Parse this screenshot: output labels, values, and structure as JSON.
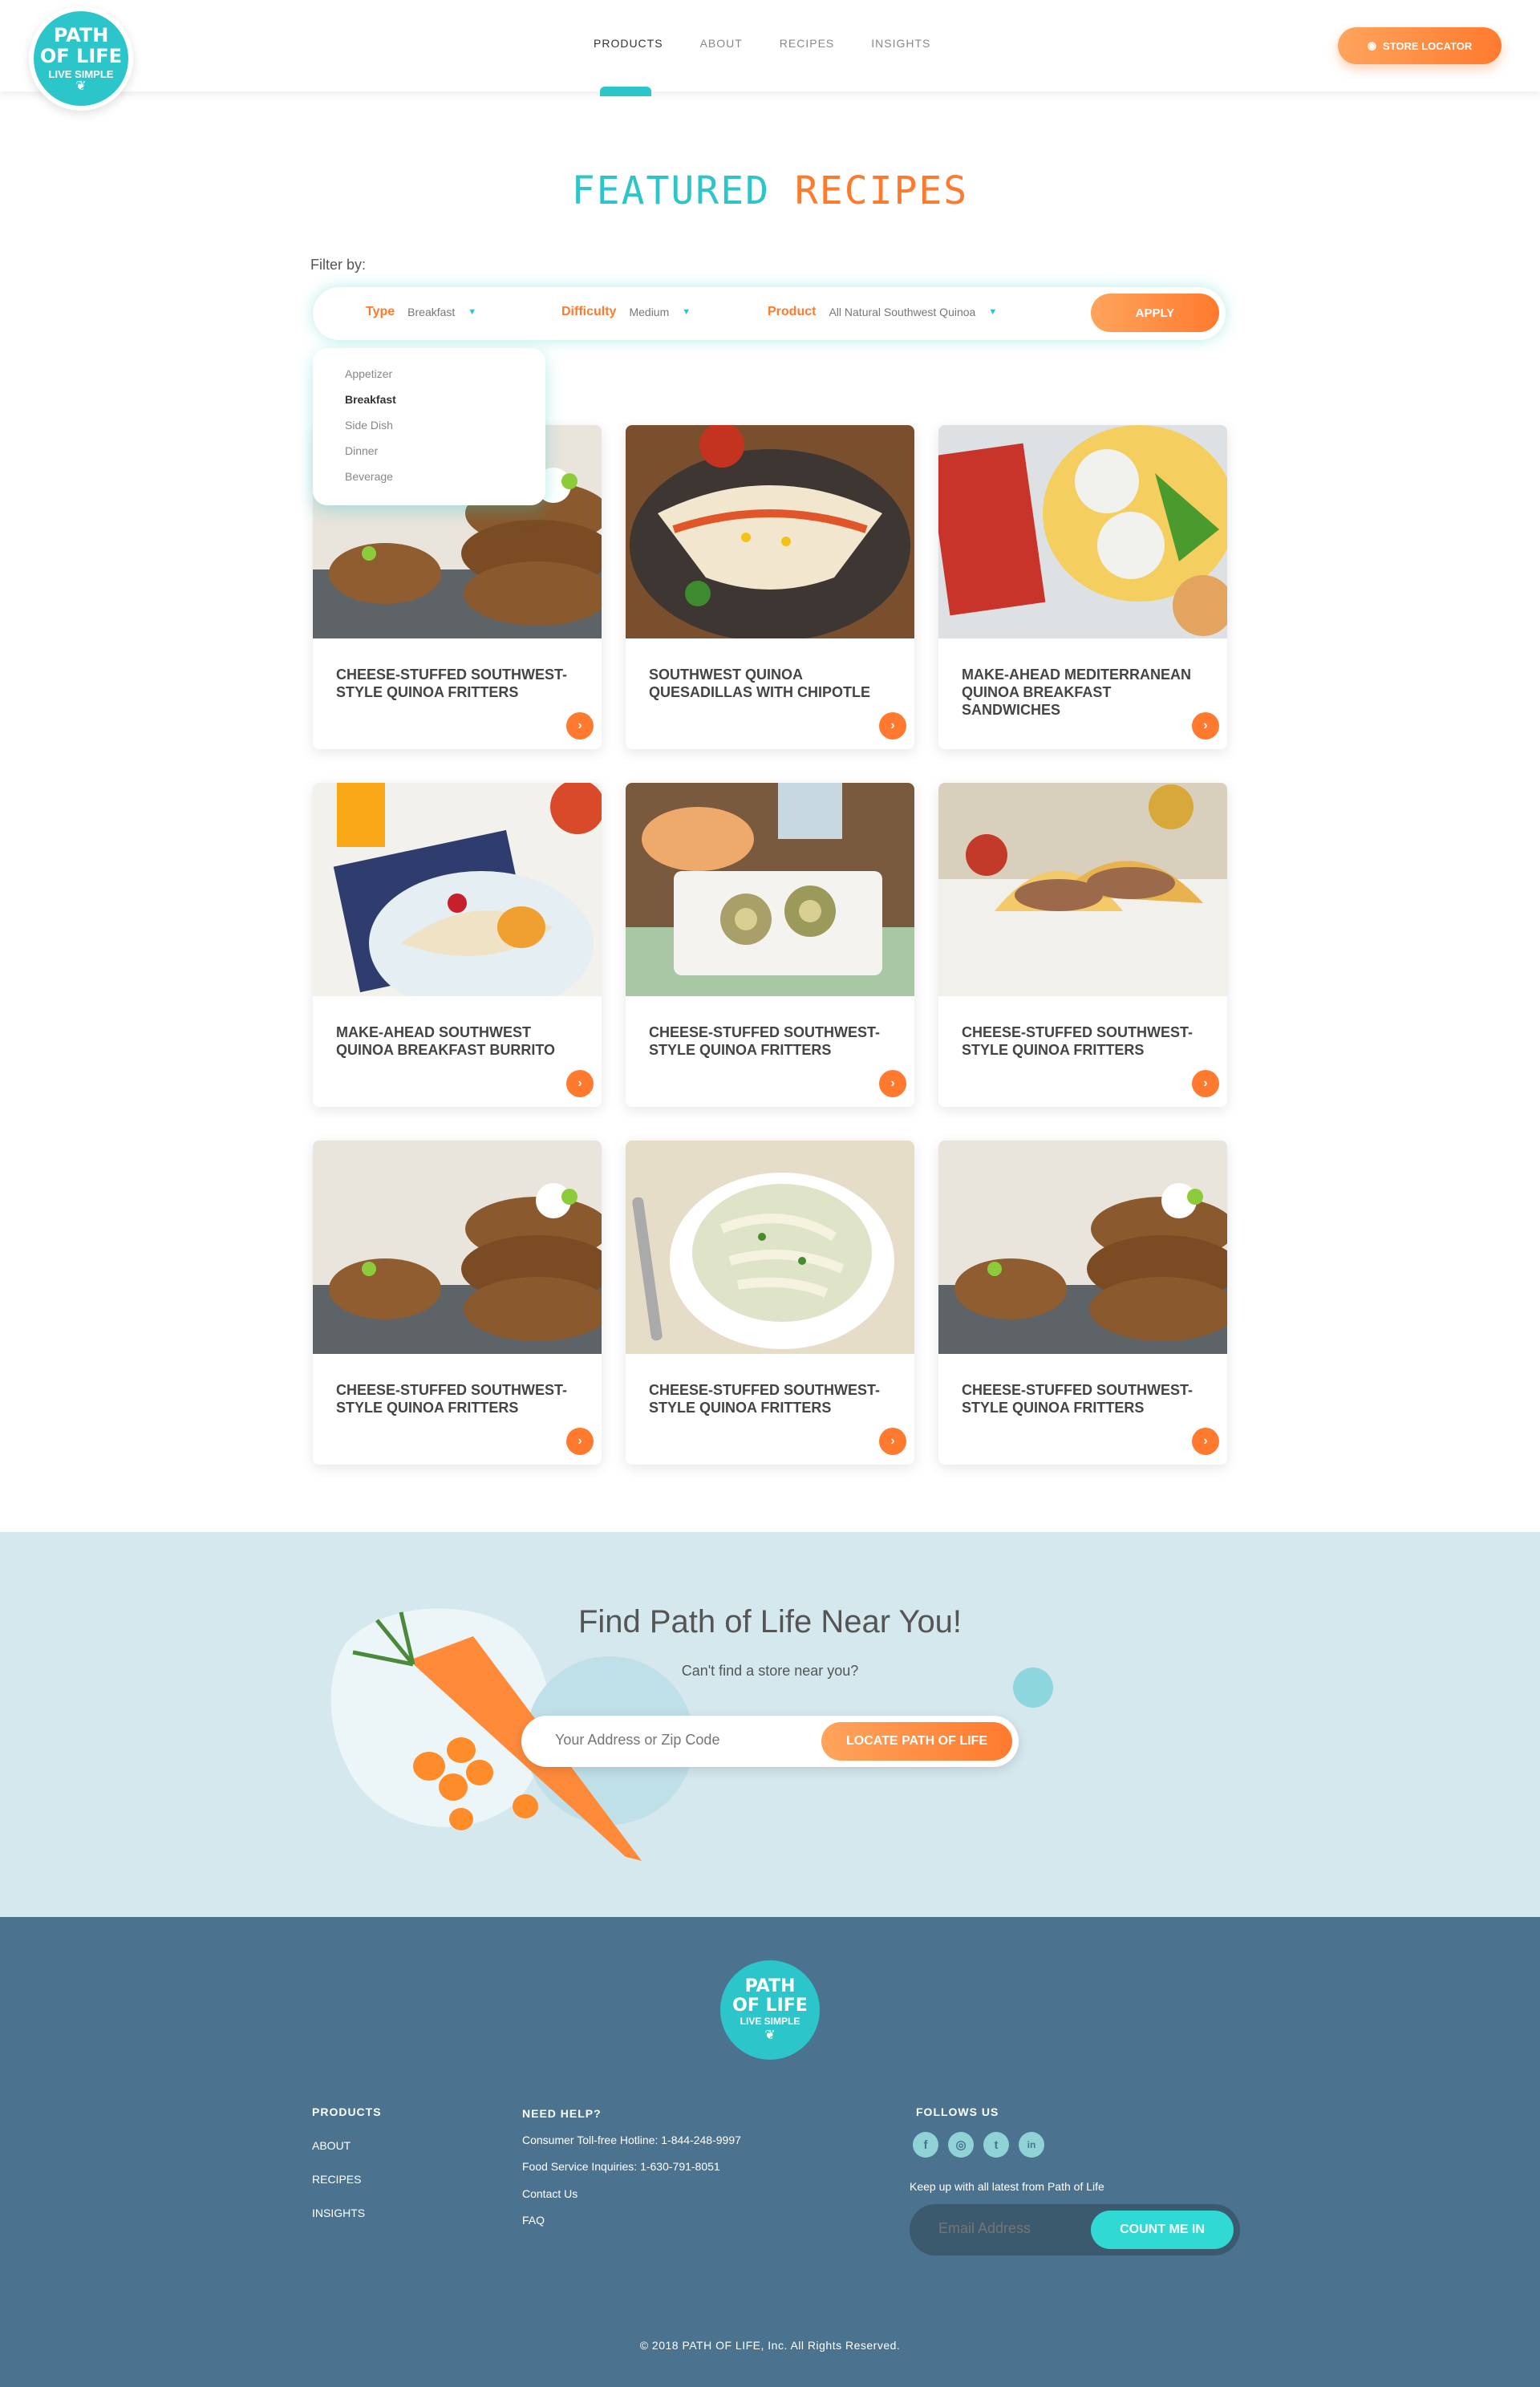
{
  "brand": {
    "logo_line1": "PATH",
    "logo_line2": "OF LIFE",
    "logo_tagline": "LIVE SIMPLE"
  },
  "nav": {
    "items": [
      "PRODUCTS",
      "ABOUT",
      "RECIPES",
      "INSIGHTS"
    ],
    "active": "PRODUCTS",
    "store_locator": "STORE LOCATOR"
  },
  "featured": {
    "title_part1": "FEATURED",
    "title_part2": "RECIPES"
  },
  "filter": {
    "label": "Filter by:",
    "type_label": "Type",
    "type_value": "Breakfast",
    "difficulty_label": "Difficulty",
    "difficulty_value": "Medium",
    "product_label": "Product",
    "product_value": "All Natural Southwest Quinoa",
    "apply": "APPLY",
    "type_options": [
      "Appetizer",
      "Breakfast",
      "Side Dish",
      "Dinner",
      "Beverage"
    ],
    "type_selected": "Breakfast"
  },
  "recipes": [
    {
      "title": "CHEESE-STUFFED SOUTHWEST-STYLE QUINOA FRITTERS",
      "image": "fritters"
    },
    {
      "title": "SOUTHWEST QUINOA QUESADILLAS WITH  CHIPOTLE",
      "image": "quesadilla"
    },
    {
      "title": "MAKE-AHEAD MEDITERRANEAN QUINOA BREAKFAST SANDWICHES",
      "image": "sandwich"
    },
    {
      "title": "MAKE-AHEAD SOUTHWEST QUINOA BREAKFAST BURRITO",
      "image": "burrito"
    },
    {
      "title": "CHEESE-STUFFED SOUTHWEST-STYLE QUINOA FRITTERS",
      "image": "pinwheels"
    },
    {
      "title": "CHEESE-STUFFED SOUTHWEST-STYLE QUINOA FRITTERS",
      "image": "tacos"
    },
    {
      "title": "CHEESE-STUFFED SOUTHWEST-STYLE QUINOA FRITTERS",
      "image": "fritters"
    },
    {
      "title": "CHEESE-STUFFED SOUTHWEST-STYLE QUINOA FRITTERS",
      "image": "soup"
    },
    {
      "title": "CHEESE-STUFFED SOUTHWEST-STYLE QUINOA FRITTERS",
      "image": "fritters"
    }
  ],
  "find": {
    "title": "Find Path of Life Near You!",
    "subtitle": "Can't find a store near you?",
    "placeholder": "Your Address or Zip Code",
    "button": "LOCATE PATH OF LIFE"
  },
  "footer": {
    "links": [
      "PRODUCTS",
      "ABOUT",
      "RECIPES",
      "INSIGHTS"
    ],
    "need_help": "NEED HELP?",
    "help_items": [
      "Consumer Toll-free Hotline: 1-844-248-9997",
      "Food Service Inquiries: 1-630-791-8051",
      "Contact Us",
      "FAQ"
    ],
    "follow": "FOLLOWS US",
    "social": [
      "facebook-icon",
      "instagram-icon",
      "twitter-icon",
      "linkedin-icon"
    ],
    "keep_up": "Keep up with all latest from Path of Life",
    "email_placeholder": "Email Address",
    "count_me_in": "COUNT ME IN",
    "copyright": "© 2018 PATH OF LIFE, Inc. All Rights Reserved."
  },
  "colors": {
    "teal": "#2cc5c9",
    "orange": "#ff7a2e",
    "footer": "#4b7390",
    "find_bg": "#d4e8ee"
  }
}
